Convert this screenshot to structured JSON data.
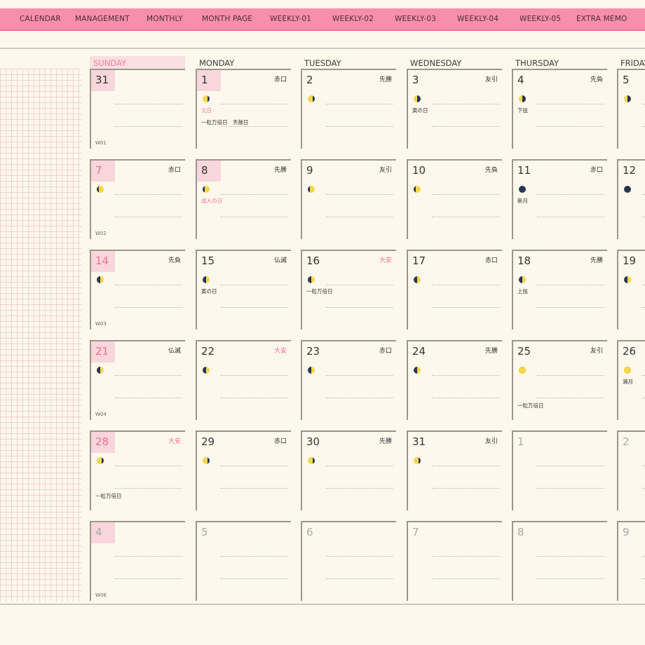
{
  "nav": [
    "CALENDAR",
    "MANAGEMENT",
    "MONTHLY",
    "MONTH PAGE",
    "WEEKLY-01",
    "WEEKLY-02",
    "WEEKLY-03",
    "WEEKLY-04",
    "WEEKLY-05",
    "EXTRA MEMO"
  ],
  "weekdays": [
    "SUNDAY",
    "MONDAY",
    "TUESDAY",
    "WEDNESDAY",
    "THURSDAY",
    "FRIDAY"
  ],
  "weeks": [
    {
      "label": "W01",
      "days": [
        {
          "num": "31",
          "muted": false,
          "hl": true,
          "moon": ""
        },
        {
          "num": "1",
          "hl": true,
          "rokuyo": "赤口",
          "moon": "gibbous",
          "notes": [
            {
              "t": "元日",
              "red": true
            },
            {
              "t": "一粒万倍日　天赦日"
            }
          ]
        },
        {
          "num": "2",
          "rokuyo": "先勝",
          "moon": "gibbous"
        },
        {
          "num": "3",
          "rokuyo": "友引",
          "moon": "half-dark-right",
          "notes": [
            {
              "t": "寅の日"
            }
          ]
        },
        {
          "num": "4",
          "rokuyo": "先負",
          "moon": "half-dark-right",
          "notes": [
            {
              "t": "下弦"
            }
          ]
        },
        {
          "num": "5",
          "rokuyo": "",
          "moon": "half-dark-right"
        }
      ]
    },
    {
      "label": "W02",
      "days": [
        {
          "num": "7",
          "hl": true,
          "sun": true,
          "rokuyo": "赤口",
          "moon": "crescent"
        },
        {
          "num": "8",
          "hl": true,
          "rokuyo": "先勝",
          "moon": "crescent",
          "notes": [
            {
              "t": "成人の日",
              "red": true
            }
          ]
        },
        {
          "num": "9",
          "rokuyo": "友引",
          "moon": "crescent"
        },
        {
          "num": "10",
          "rokuyo": "先負",
          "moon": "crescent"
        },
        {
          "num": "11",
          "rokuyo": "赤口",
          "moon": "new",
          "notes": [
            {
              "t": "新月"
            }
          ]
        },
        {
          "num": "12",
          "rokuyo": "",
          "moon": "new"
        }
      ]
    },
    {
      "label": "W03",
      "days": [
        {
          "num": "14",
          "hl": true,
          "sun": true,
          "rokuyo": "先負",
          "moon": "half-dark-left"
        },
        {
          "num": "15",
          "rokuyo": "仏滅",
          "moon": "half-dark-left",
          "notes": [
            {
              "t": "寅の日"
            }
          ]
        },
        {
          "num": "16",
          "rokuyo": "大安",
          "rokuyoRed": true,
          "moon": "half-dark-left",
          "notes": [
            {
              "t": "一粒万倍日"
            }
          ]
        },
        {
          "num": "17",
          "rokuyo": "赤口",
          "moon": "half-dark-left"
        },
        {
          "num": "18",
          "rokuyo": "先勝",
          "moon": "half-dark-left",
          "notes": [
            {
              "t": "上弦"
            }
          ]
        },
        {
          "num": "19",
          "rokuyo": "",
          "moon": "half-dark-left"
        }
      ]
    },
    {
      "label": "W04",
      "days": [
        {
          "num": "21",
          "hl": true,
          "sun": true,
          "rokuyo": "仏滅",
          "moon": "half-dark-left"
        },
        {
          "num": "22",
          "rokuyo": "大安",
          "rokuyoRed": true,
          "moon": "half-dark-left"
        },
        {
          "num": "23",
          "rokuyo": "赤口",
          "moon": "half-dark-left"
        },
        {
          "num": "24",
          "rokuyo": "先勝",
          "moon": "half-dark-left"
        },
        {
          "num": "25",
          "rokuyo": "友引",
          "moon": "full",
          "notes": [
            {
              "t": "一粒万倍日",
              "pos": 2
            }
          ]
        },
        {
          "num": "26",
          "rokuyo": "",
          "moon": "full",
          "notes": [
            {
              "t": "満月"
            }
          ]
        }
      ]
    },
    {
      "label": "",
      "days": [
        {
          "num": "28",
          "hl": true,
          "sun": true,
          "rokuyo": "大安",
          "rokuyoRed": true,
          "moon": "gibbous",
          "notes": [
            {
              "t": "一粒万倍日",
              "pos": 2
            }
          ]
        },
        {
          "num": "29",
          "rokuyo": "赤口",
          "moon": "gibbous"
        },
        {
          "num": "30",
          "rokuyo": "先勝",
          "moon": "gibbous"
        },
        {
          "num": "31",
          "rokuyo": "友引",
          "moon": "gibbous"
        },
        {
          "num": "1",
          "muted": true,
          "moon": ""
        },
        {
          "num": "2",
          "muted": true,
          "moon": ""
        }
      ]
    },
    {
      "label": "W06",
      "days": [
        {
          "num": "4",
          "muted": true,
          "hl": true,
          "moon": ""
        },
        {
          "num": "5",
          "muted": true,
          "moon": ""
        },
        {
          "num": "6",
          "muted": true,
          "moon": ""
        },
        {
          "num": "7",
          "muted": true,
          "moon": ""
        },
        {
          "num": "8",
          "muted": true,
          "moon": ""
        },
        {
          "num": "9",
          "muted": true,
          "moon": ""
        }
      ]
    }
  ]
}
